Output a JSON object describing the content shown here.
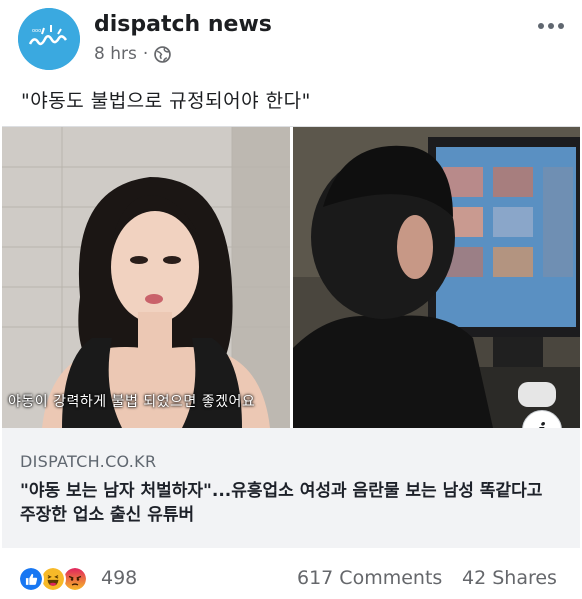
{
  "post": {
    "page_name": "dispatch news",
    "time": "8 hrs",
    "separator": "·",
    "visibility_icon": "globe-icon",
    "more_icon": "more-dots-icon",
    "text": "\"야동도 불법으로 규정되어야 한다\"",
    "avatar_icon": "dispatch-logo"
  },
  "link_card": {
    "image_subtitle": "야동이 강력하게 불법 되었으면 좋겠어요",
    "info_label": "i",
    "domain": "DISPATCH.CO.KR",
    "title": "\"야동 보는 남자 처벌하자\"...유흥업소 여성과 음란물 보는 남성 똑같다고 주장한 업소 출신 유튜버"
  },
  "engagement": {
    "reaction_icons": [
      "like-icon",
      "haha-icon",
      "angry-icon"
    ],
    "reaction_count": "498",
    "comments": "617 Comments",
    "shares": "42 Shares"
  },
  "colors": {
    "like": "#1877f2",
    "haha": "#f7b928",
    "angry": "#e9710f",
    "avatar": "#3aa9e0"
  }
}
